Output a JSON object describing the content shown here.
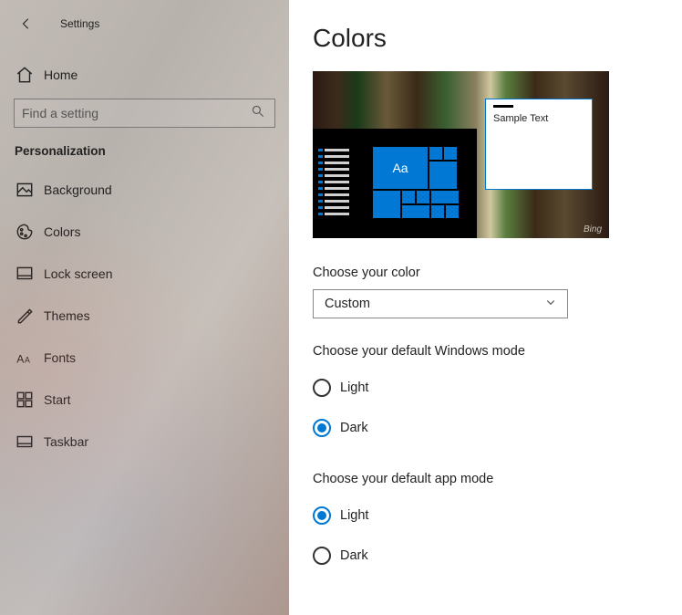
{
  "header": {
    "back": "Settings"
  },
  "sidebar": {
    "home": "Home",
    "search_placeholder": "Find a setting",
    "section": "Personalization",
    "items": [
      {
        "label": "Background"
      },
      {
        "label": "Colors"
      },
      {
        "label": "Lock screen"
      },
      {
        "label": "Themes"
      },
      {
        "label": "Fonts"
      },
      {
        "label": "Start"
      },
      {
        "label": "Taskbar"
      }
    ]
  },
  "main": {
    "title": "Colors",
    "preview": {
      "tile_text": "Aa",
      "sample_text": "Sample Text",
      "watermark": "Bing"
    },
    "color_select": {
      "label": "Choose your color",
      "value": "Custom"
    },
    "windows_mode": {
      "label": "Choose your default Windows mode",
      "options": [
        "Light",
        "Dark"
      ],
      "selected": "Dark"
    },
    "app_mode": {
      "label": "Choose your default app mode",
      "options": [
        "Light",
        "Dark"
      ],
      "selected": "Light"
    }
  }
}
